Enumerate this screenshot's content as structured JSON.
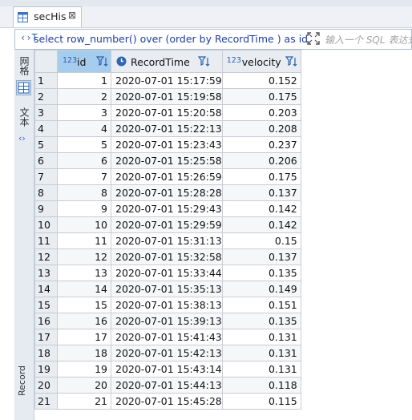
{
  "tab": {
    "title": "secHis",
    "close_glyph": "⊠"
  },
  "sql": {
    "icon_text": "‹›T",
    "query": "select row_number() over (order by RecordTime ) as id, F",
    "filter_placeholder": "输入一个 SQL 表达式"
  },
  "sidebar": {
    "grid_label": "网格",
    "text_label": "文本",
    "bottom_label": "Record"
  },
  "columns": [
    {
      "type": "123",
      "name": "id"
    },
    {
      "type": "",
      "name": "RecordTime"
    },
    {
      "type": "123",
      "name": "velocity"
    }
  ],
  "rows": [
    {
      "n": "1",
      "id": "1",
      "time": "2020-07-01 15:17:59",
      "vel": "0.152"
    },
    {
      "n": "2",
      "id": "2",
      "time": "2020-07-01 15:19:58",
      "vel": "0.175"
    },
    {
      "n": "3",
      "id": "3",
      "time": "2020-07-01 15:20:58",
      "vel": "0.203"
    },
    {
      "n": "4",
      "id": "4",
      "time": "2020-07-01 15:22:13",
      "vel": "0.208"
    },
    {
      "n": "5",
      "id": "5",
      "time": "2020-07-01 15:23:43",
      "vel": "0.237"
    },
    {
      "n": "6",
      "id": "6",
      "time": "2020-07-01 15:25:58",
      "vel": "0.206"
    },
    {
      "n": "7",
      "id": "7",
      "time": "2020-07-01 15:26:59",
      "vel": "0.175"
    },
    {
      "n": "8",
      "id": "8",
      "time": "2020-07-01 15:28:28",
      "vel": "0.137"
    },
    {
      "n": "9",
      "id": "9",
      "time": "2020-07-01 15:29:43",
      "vel": "0.142"
    },
    {
      "n": "10",
      "id": "10",
      "time": "2020-07-01 15:29:59",
      "vel": "0.142"
    },
    {
      "n": "11",
      "id": "11",
      "time": "2020-07-01 15:31:13",
      "vel": "0.15"
    },
    {
      "n": "12",
      "id": "12",
      "time": "2020-07-01 15:32:58",
      "vel": "0.137"
    },
    {
      "n": "13",
      "id": "13",
      "time": "2020-07-01 15:33:44",
      "vel": "0.135"
    },
    {
      "n": "14",
      "id": "14",
      "time": "2020-07-01 15:35:13",
      "vel": "0.149"
    },
    {
      "n": "15",
      "id": "15",
      "time": "2020-07-01 15:38:13",
      "vel": "0.151"
    },
    {
      "n": "16",
      "id": "16",
      "time": "2020-07-01 15:39:13",
      "vel": "0.135"
    },
    {
      "n": "17",
      "id": "17",
      "time": "2020-07-01 15:41:43",
      "vel": "0.131"
    },
    {
      "n": "18",
      "id": "18",
      "time": "2020-07-01 15:42:13",
      "vel": "0.131"
    },
    {
      "n": "19",
      "id": "19",
      "time": "2020-07-01 15:43:14",
      "vel": "0.131"
    },
    {
      "n": "20",
      "id": "20",
      "time": "2020-07-01 15:44:13",
      "vel": "0.118"
    },
    {
      "n": "21",
      "id": "21",
      "time": "2020-07-01 15:45:28",
      "vel": "0.115"
    }
  ]
}
